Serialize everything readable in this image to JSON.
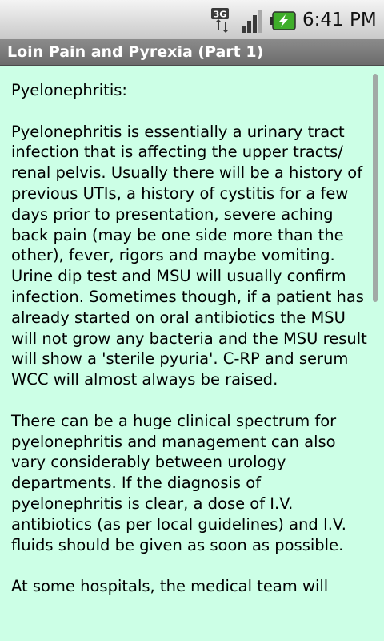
{
  "status_bar": {
    "network_type": "3G",
    "time": "6:41 PM"
  },
  "header": {
    "title": "Loin Pain and Pyrexia (Part 1)"
  },
  "article": {
    "heading": "Pyelonephritis:",
    "paragraphs": [
      "Pyelonephritis is essentially a urinary tract infection that is affecting the upper tracts/ renal pelvis. Usually there will be a history of previous UTIs, a history of cystitis for a few days prior to presentation, severe aching back pain (may be one side more than the other), fever, rigors and maybe vomiting. Urine dip test and MSU will usually confirm infection. Sometimes though, if a patient has already started on oral antibiotics the MSU will not grow any bacteria and the MSU result will show a 'sterile pyuria'. C-RP and serum WCC will almost always be raised.",
      "There can be a huge clinical spectrum for pyelonephritis and management can also vary considerably between urology departments. If the diagnosis of pyelonephritis is clear, a dose of I.V. antibiotics (as per local guidelines) and I.V. fluids should be given as soon as possible.",
      "At some hospitals, the medical team will"
    ]
  },
  "colors": {
    "content_background": "#ccffe6",
    "title_bar_background": "#7a7a7a",
    "status_bar_background": "#dcdcdc",
    "battery_accent": "#3fae2a"
  }
}
